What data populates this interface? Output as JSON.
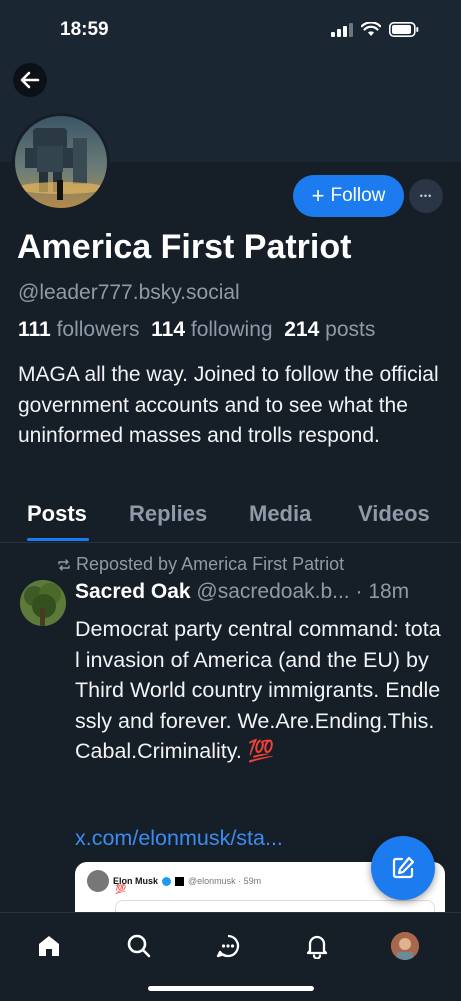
{
  "status_bar": {
    "time": "18:59"
  },
  "profile": {
    "display_name": "America First Patriot",
    "handle": "@leader777.bsky.social",
    "followers_count": "111",
    "followers_label": "followers",
    "following_count": "114",
    "following_label": "following",
    "posts_count": "214",
    "posts_label": "posts",
    "bio": "MAGA all the way.  Joined to follow the official government accounts and to see what the uninformed masses and trolls respond.",
    "follow_label": "Follow",
    "more_label": "•••"
  },
  "tabs": [
    {
      "label": "Posts",
      "active": true
    },
    {
      "label": "Replies",
      "active": false
    },
    {
      "label": "Media",
      "active": false
    },
    {
      "label": "Videos",
      "active": false
    }
  ],
  "post": {
    "repost_label": "Reposted by America First Patriot",
    "author_name": "Sacred Oak",
    "author_handle": "@sacredoak.b...",
    "time": "· 18m",
    "body": "Democrat party central command: total invasion of America (and the EU) by Third World country immigrants. Endlessly and forever. We.Are.Ending.This.Cabal.Criminality. 💯",
    "link": "x.com/elonmusk/sta...",
    "embed": {
      "author": "Elon Musk",
      "handle": "@elonmusk · 59m",
      "emoji": "💯"
    }
  },
  "bottom_nav": [
    "home-icon",
    "search-icon",
    "chat-icon",
    "notifications-icon",
    "profile-avatar"
  ],
  "colors": {
    "accent": "#1d7bf0",
    "background": "#161e27",
    "muted": "#8e9aa8"
  }
}
